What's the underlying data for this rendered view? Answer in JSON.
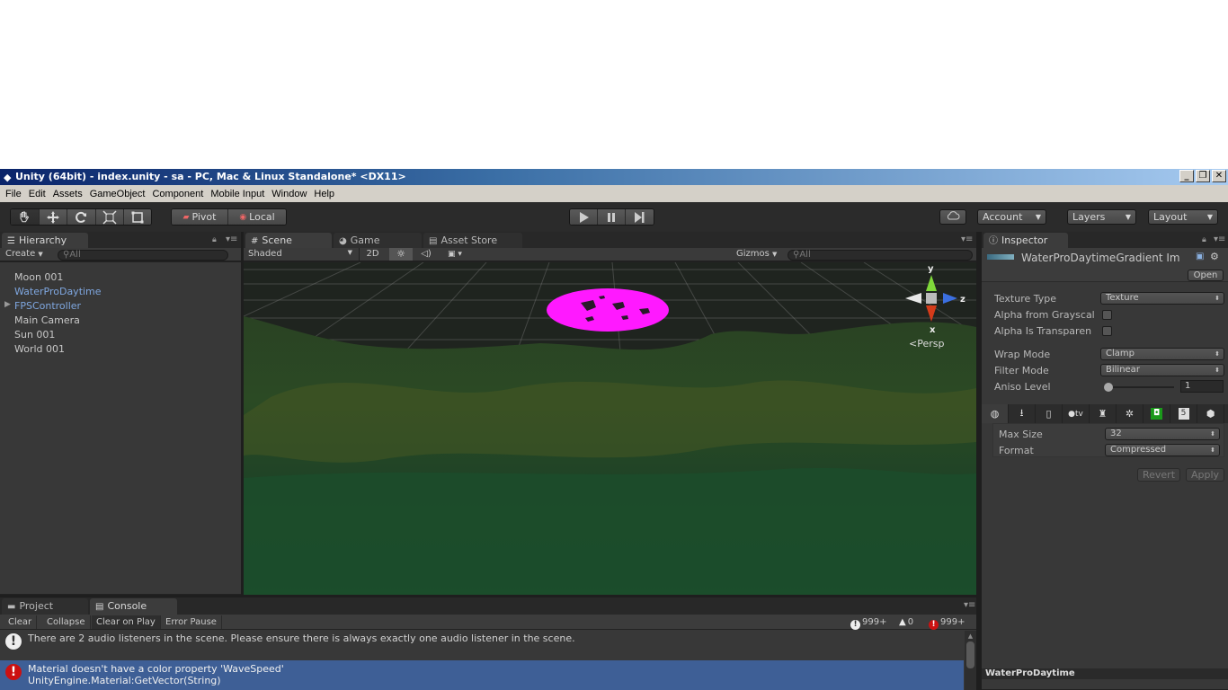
{
  "window": {
    "title": "Unity (64bit) - index.unity - sa - PC, Mac & Linux Standalone* <DX11>",
    "minimize": "_",
    "restore": "❐",
    "close": "✕"
  },
  "menu": [
    "File",
    "Edit",
    "Assets",
    "GameObject",
    "Component",
    "Mobile Input",
    "Window",
    "Help"
  ],
  "toolbar": {
    "pivot": "Pivot",
    "local": "Local",
    "account": "Account",
    "layers": "Layers",
    "layout": "Layout"
  },
  "hierarchy": {
    "tab": "Hierarchy",
    "create": "Create",
    "search_placeholder": "All",
    "items": [
      "Moon 001",
      "WaterProDaytime",
      "FPSController",
      "Main Camera",
      "Sun 001",
      "World 001"
    ]
  },
  "scene": {
    "tabs": [
      "Scene",
      "Game",
      "Asset Store"
    ],
    "shading": "Shaded",
    "mode2d": "2D",
    "gizmos": "Gizmos",
    "search_placeholder": "All",
    "gizmo_y": "y",
    "gizmo_z": "z",
    "gizmo_x": "x",
    "persp": "Persp"
  },
  "inspector": {
    "tab": "Inspector",
    "asset_name": "WaterProDaytimeGradient Im",
    "open": "Open",
    "texture_type_label": "Texture Type",
    "texture_type_value": "Texture",
    "alpha_gray_label": "Alpha from Grayscal",
    "alpha_transp_label": "Alpha Is Transparen",
    "wrap_label": "Wrap Mode",
    "wrap_value": "Clamp",
    "filter_label": "Filter Mode",
    "filter_value": "Bilinear",
    "aniso_label": "Aniso Level",
    "aniso_value": "1",
    "maxsize_label": "Max Size",
    "maxsize_value": "32",
    "format_label": "Format",
    "format_value": "Compressed",
    "revert": "Revert",
    "apply": "Apply",
    "preview_name": "WaterProDaytime",
    "platform_appletv": "tv"
  },
  "bottom": {
    "tabs": [
      "Project",
      "Console"
    ],
    "buttons": [
      "Clear",
      "Collapse",
      "Clear on Play",
      "Error Pause"
    ],
    "info_count": "999+",
    "warn_count": "0",
    "error_count": "999+",
    "log1": "There are 2 audio listeners in the scene. Please ensure there is always exactly one audio listener in the scene.",
    "log2_line1": "Material doesn't have a color property 'WaveSpeed'",
    "log2_line2": "UnityEngine.Material:GetVector(String)"
  },
  "colors": {
    "selected_row": "#3e5f96",
    "magenta_water": "#ff19ff",
    "error": "#cc1111"
  }
}
